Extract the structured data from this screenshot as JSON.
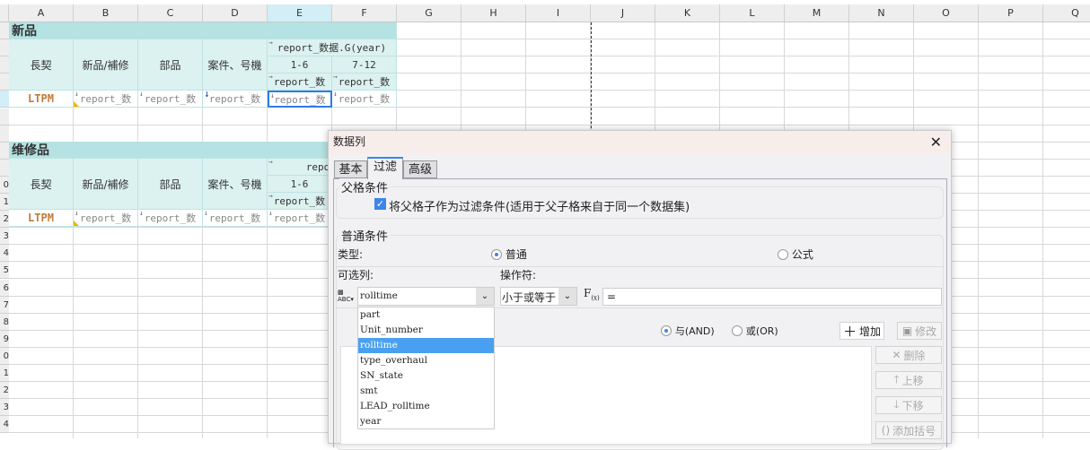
{
  "columns": [
    "A",
    "B",
    "C",
    "D",
    "E",
    "F",
    "G",
    "H",
    "I",
    "J",
    "K",
    "L",
    "M",
    "N",
    "O",
    "P",
    "Q"
  ],
  "row_numbers": [
    "",
    "",
    "",
    "",
    "",
    "",
    "",
    "",
    "",
    "0",
    "1",
    "2",
    "3",
    "4",
    "5",
    "6",
    "7",
    "8",
    "9",
    "0",
    "1",
    "2",
    "3",
    "4"
  ],
  "sheet": {
    "section1": {
      "title": "新品",
      "headers": [
        "長契",
        "新品/補修",
        "部品",
        "案件、号機"
      ],
      "group_header": "report_数据.G(year)",
      "sub_headers": [
        "1-6",
        "7-12"
      ],
      "sub_cells": [
        "report_数",
        "report_数"
      ],
      "row_first": "LTPM",
      "row_cells": [
        "report_数",
        "report_数",
        "report_数",
        "report_数",
        "report_数"
      ]
    },
    "section2": {
      "title": "维修品",
      "headers": [
        "長契",
        "新品/補修",
        "部品",
        "案件、号機"
      ],
      "group_header": "report_数",
      "sub_headers": [
        "1-6"
      ],
      "sub_cells": [
        "report_数"
      ],
      "row_first": "LTPM",
      "row_cells": [
        "report_数",
        "report_数",
        "report_数",
        "report_数"
      ]
    }
  },
  "dialog": {
    "title": "数据列",
    "tabs": [
      "基本",
      "过滤",
      "高级"
    ],
    "parent_group": "父格条件",
    "parent_checkbox": "将父格子作为过滤条件(适用于父子格来自于同一个数据集)",
    "normal_group": "普通条件",
    "type_label": "类型:",
    "type_options": [
      "普通",
      "公式"
    ],
    "column_label": "可选列:",
    "operator_label": "操作符:",
    "column_value": "rolltime",
    "operator_value": "小于或等于",
    "formula_value": "=",
    "column_options": [
      "part",
      "Unit_number",
      "rolltime",
      "type_overhaul",
      "SN_state",
      "smt",
      "LEAD_rolltime",
      "year"
    ],
    "logic_options": [
      "与(AND)",
      "或(OR)"
    ],
    "buttons": {
      "add": "增加",
      "modify": "修改",
      "delete": "删除",
      "up": "上移",
      "down": "下移",
      "bracket": "添加括号"
    }
  }
}
